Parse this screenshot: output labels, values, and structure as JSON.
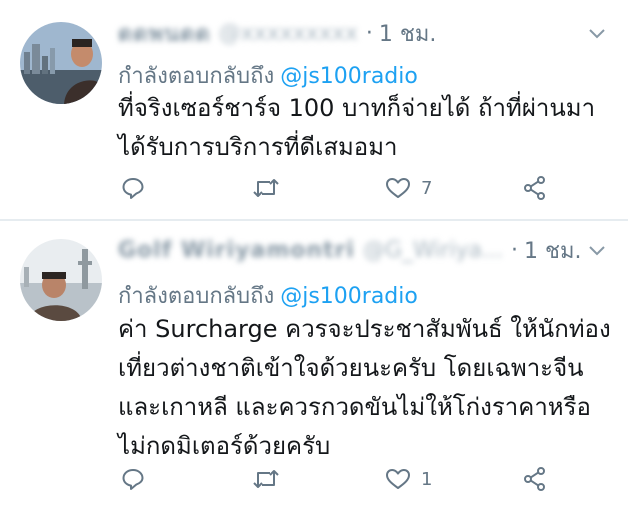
{
  "tweets": [
    {
      "display_name": "ดดพนดด",
      "handle": "@xxxxxxxxx",
      "separator": "·",
      "time": "1 ชม.",
      "replying_prefix": "กำลังตอบกลับถึง",
      "replying_to": "@js100radio",
      "text_lines": [
        "ที่จริงเซอร์ชาร์จ 100 บาทก็จ่ายได้ ถ้าที่ผ่านมา",
        "ได้รับการบริการที่ดีเสมอมา"
      ],
      "like_count": "7"
    },
    {
      "display_name": "Golf Wiriyamontri",
      "handle": "@G_Wiriya...",
      "separator": "·",
      "time": "1 ชม.",
      "replying_prefix": "กำลังตอบกลับถึง",
      "replying_to": "@js100radio",
      "text_lines": [
        "ค่า Surcharge ควรจะประชาสัมพันธ์ ให้นักท่อง",
        "เที่ยวต่างชาติเข้าใจด้วยนะครับ โดยเฉพาะจีน",
        "และเกาหลี และควรกวดขันไม่ให้โก่งราคาหรือ",
        "ไม่กดมิเตอร์ด้วยครับ"
      ],
      "like_count": "1"
    }
  ],
  "icons": {
    "reply": "reply-icon",
    "retweet": "retweet-icon",
    "like": "heart-icon",
    "share": "share-icon",
    "menu": "chevron-down-icon"
  },
  "colors": {
    "link": "#1da1f2",
    "secondary_text": "#657786",
    "divider": "#e6ecf0"
  }
}
